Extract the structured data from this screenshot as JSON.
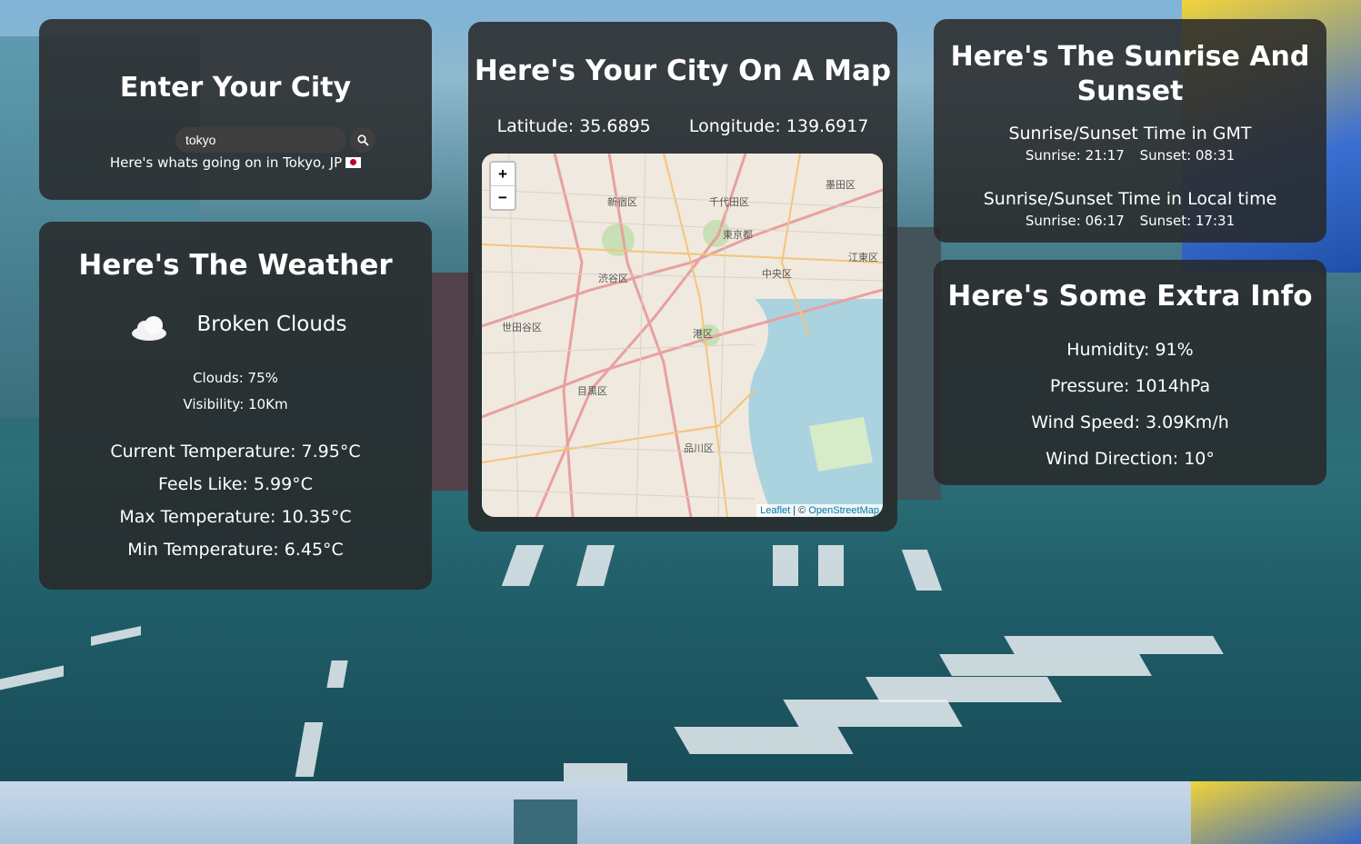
{
  "city_card": {
    "title": "Enter Your City",
    "search_value": "tokyo",
    "search_placeholder": "",
    "message": "Here's whats going on in Tokyo, JP"
  },
  "weather_card": {
    "title": "Here's The Weather",
    "condition": "Broken Clouds",
    "clouds": "Clouds: 75%",
    "visibility": "Visibility: 10Km",
    "current_temp": "Current Temperature: 7.95°C",
    "feels_like": "Feels Like: 5.99°C",
    "max_temp": "Max Temperature: 10.35°C",
    "min_temp": "Min Temperature: 6.45°C"
  },
  "map_card": {
    "title": "Here's Your City On A Map",
    "latitude": "Latitude: 35.6895",
    "longitude": "Longitude: 139.6917",
    "zoom_in": "+",
    "zoom_out": "−",
    "attribution_leaflet": "Leaflet",
    "attribution_sep": " | © ",
    "attribution_osm": "OpenStreetMap",
    "map_labels": [
      "新宿区",
      "千代田区",
      "墨田区",
      "東京都",
      "江東区",
      "渋谷区",
      "中央区",
      "世田谷区",
      "港区",
      "目黒区",
      "品川区"
    ]
  },
  "sun_card": {
    "title": "Here's The Sunrise And Sunset",
    "gmt_title": "Sunrise/Sunset Time in GMT",
    "gmt_sunrise": "Sunrise: 21:17",
    "gmt_sunset": "Sunset: 08:31",
    "local_title": "Sunrise/Sunset Time in Local time",
    "local_sunrise": "Sunrise: 06:17",
    "local_sunset": "Sunset: 17:31"
  },
  "extra_card": {
    "title": "Here's Some Extra Info",
    "humidity": "Humidity: 91%",
    "pressure": "Pressure: 1014hPa",
    "wind_speed": "Wind Speed: 3.09Km/h",
    "wind_direction": "Wind Direction: 10°"
  },
  "colors": {
    "card_bg": "#282828",
    "flag_red": "#bc002d"
  }
}
